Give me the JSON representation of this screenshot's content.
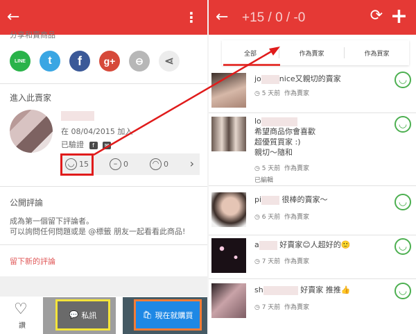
{
  "left": {
    "share_title": "分享和賣商品",
    "share_buttons": [
      {
        "label": "LINE",
        "icon": "line-icon"
      },
      {
        "label": "t",
        "icon": "twitter-icon"
      },
      {
        "label": "f",
        "icon": "facebook-icon"
      },
      {
        "label": "g+",
        "icon": "google-plus-icon"
      },
      {
        "label": "⊖",
        "icon": "link-icon"
      },
      {
        "label": "⋖",
        "icon": "share-icon"
      }
    ],
    "seller_section_title": "進入此賣家",
    "joined": "在 08/04/2015 加入",
    "verified": "已驗證",
    "ratings": {
      "good": "15",
      "neutral": "0",
      "bad": "0"
    },
    "comments_title": "公開評論",
    "comments_hint_1": "成為第一個留下評論者。",
    "comments_hint_2": "可以詢問任何問題或是 @標籤 朋友一起看看此商品!",
    "new_comment": "留下新的評論",
    "like_label": "讚",
    "message_label": "私訊",
    "buy_label": "現在就購買"
  },
  "right": {
    "title": "+15 / 0 / -0",
    "tabs": [
      "全部",
      "作為賣家",
      "作為買家"
    ],
    "feedback": [
      {
        "name": "jo",
        "text": "nice又親切的賣家",
        "time": "5 天前",
        "role": "作為賣家",
        "lines": []
      },
      {
        "name": "lo",
        "text": "",
        "time": "5 天前",
        "role": "作為賣家",
        "lines": [
          "希望商品你會喜歡",
          "超優質買家 :)",
          "親切〜隨和"
        ],
        "edited": "已編輯"
      },
      {
        "name": "pi",
        "text": "很棒的賣家〜",
        "time": "6 天前",
        "role": "作為賣家",
        "lines": []
      },
      {
        "name": "a",
        "text": "好賣家😊人超好的🙂",
        "time": "7 天前",
        "role": "作為賣家",
        "lines": []
      },
      {
        "name": "sh",
        "text": "好賣家 推推👍",
        "time": "7 天前",
        "role": "作為賣家",
        "lines": []
      }
    ]
  },
  "colors": {
    "brand": "#e53935",
    "positive": "#4caf50",
    "highlight_red": "#e01b1b",
    "highlight_yellow": "#f4e43a",
    "highlight_orange": "#f57c36"
  }
}
